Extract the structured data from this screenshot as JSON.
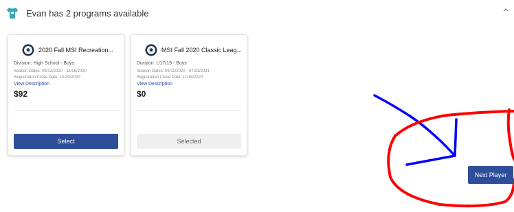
{
  "header": {
    "title": "Evan has 2 programs available",
    "icon": "tshirt-icon",
    "chevron": "^"
  },
  "programs": [
    {
      "title": "2020 Fall MSI Recreation...",
      "division": "Division: High School - Boys",
      "season_dates": "Season Dates: 09/12/2020 - 11/16/2020",
      "registration_close": "Registration Close Date: 10/30/2020",
      "view_description": "View Description",
      "price": "$92",
      "button_label": "Select",
      "selected": false
    },
    {
      "title": "MSI Fall 2020 Classic Leag...",
      "division": "Division: U17/19 - Boys",
      "season_dates": "Season Dates: 09/11/2020 - 07/31/2021",
      "registration_close": "Registration Close Date: 11/15/2020",
      "view_description": "View Description",
      "price": "$0",
      "button_label": "Selected",
      "selected": true
    }
  ],
  "next_player_label": "Next Player",
  "colors": {
    "primary": "#2f4e9a",
    "icon_teal": "#3aa7b5",
    "scribble_blue": "#0000ff",
    "scribble_red": "#ff0000"
  }
}
